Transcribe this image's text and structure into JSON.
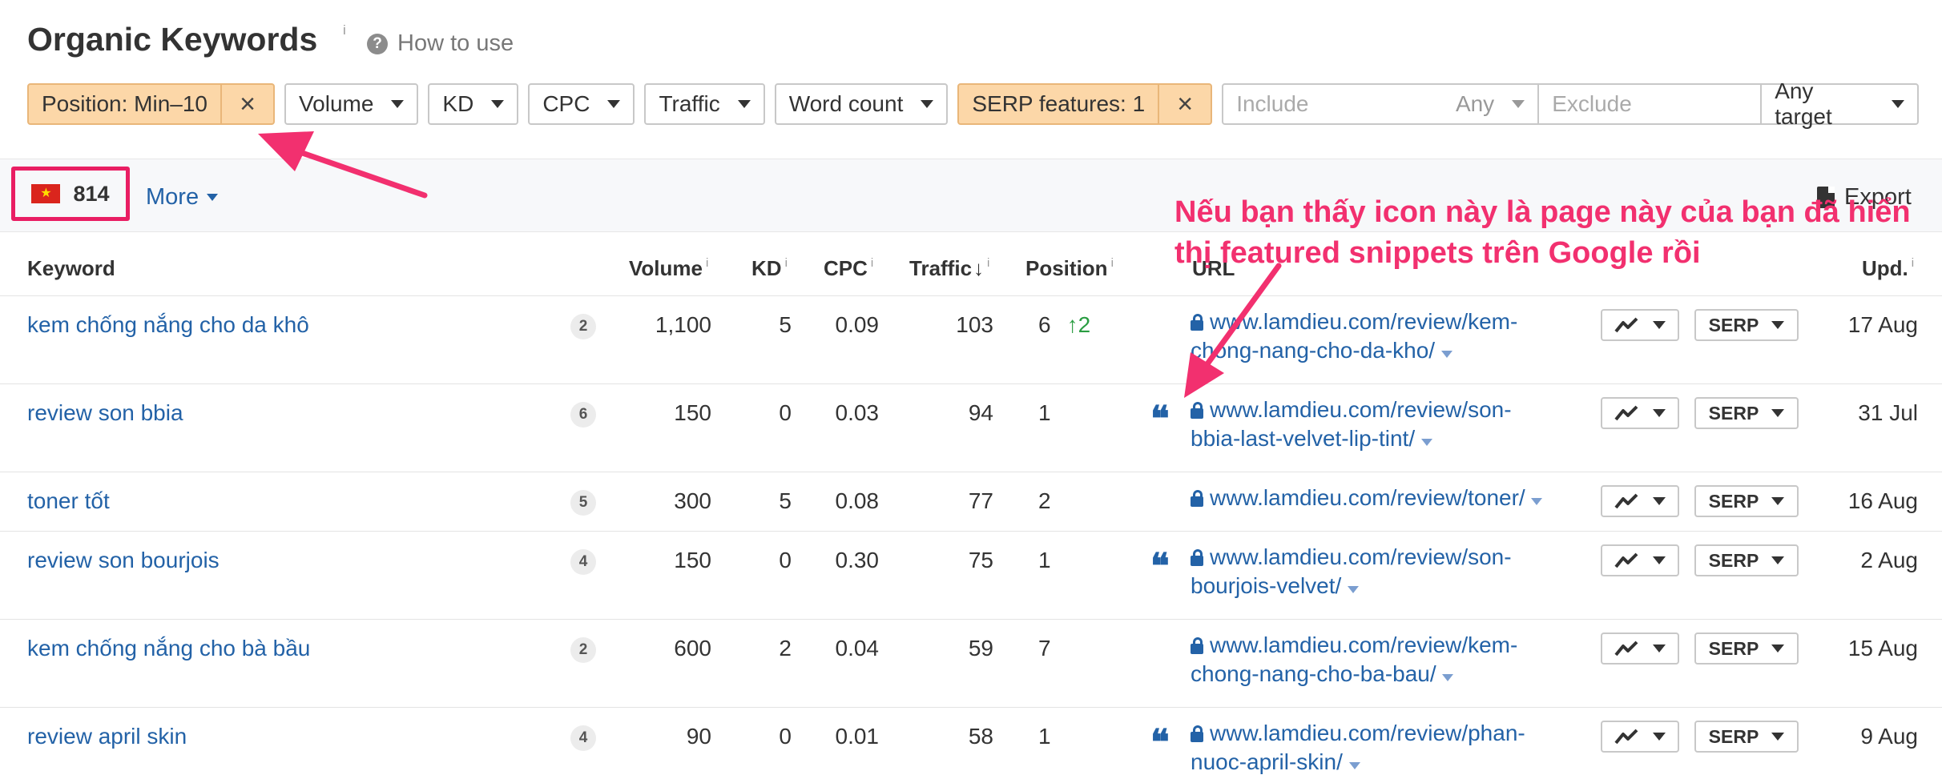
{
  "header": {
    "title": "Organic Keywords",
    "title_info": "i",
    "how_to_use": "How to use",
    "how_to_icon_glyph": "?"
  },
  "filters": {
    "position": "Position: Min–10",
    "volume": "Volume",
    "kd": "KD",
    "cpc": "CPC",
    "traffic": "Traffic",
    "word_count": "Word count",
    "serp_features": "SERP features: 1",
    "include_placeholder": "Include",
    "include_mode": "Any",
    "exclude_placeholder": "Exclude",
    "target": "Any target",
    "close_glyph": "×"
  },
  "summary": {
    "count": "814",
    "flag_glyph": "★",
    "more": "More",
    "export": "Export"
  },
  "table": {
    "headers": {
      "keyword": "Keyword",
      "volume": "Volume",
      "kd": "KD",
      "cpc": "CPC",
      "traffic": "Traffic",
      "traffic_arrow": "↓",
      "position": "Position",
      "url": "URL",
      "updated": "Upd.",
      "info": "i"
    },
    "serp_label": "SERP",
    "quote_glyph": "❝",
    "rows": [
      {
        "keyword": "kem chống nắng cho da khô",
        "words": "2",
        "volume": "1,100",
        "kd": "5",
        "cpc": "0.09",
        "traffic": "103",
        "position": "6",
        "change": "↑2",
        "url": "www.lamdieu.com/review/kem-chong-nang-cho-da-kho/",
        "updated": "17 Aug"
      },
      {
        "keyword": "review son bbia",
        "words": "6",
        "volume": "150",
        "kd": "0",
        "cpc": "0.03",
        "traffic": "94",
        "position": "1",
        "change": "",
        "url": "www.lamdieu.com/review/son-bbia-last-velvet-lip-tint/",
        "updated": "31 Jul"
      },
      {
        "keyword": "toner tốt",
        "words": "5",
        "volume": "300",
        "kd": "5",
        "cpc": "0.08",
        "traffic": "77",
        "position": "2",
        "change": "",
        "url": "www.lamdieu.com/review/toner/",
        "updated": "16 Aug"
      },
      {
        "keyword": "review son bourjois",
        "words": "4",
        "volume": "150",
        "kd": "0",
        "cpc": "0.30",
        "traffic": "75",
        "position": "1",
        "change": "",
        "url": "www.lamdieu.com/review/son-bourjois-velvet/",
        "updated": "2 Aug"
      },
      {
        "keyword": "kem chống nắng cho bà bầu",
        "words": "2",
        "volume": "600",
        "kd": "2",
        "cpc": "0.04",
        "traffic": "59",
        "position": "7",
        "change": "",
        "url": "www.lamdieu.com/review/kem-chong-nang-cho-ba-bau/",
        "updated": "15 Aug"
      },
      {
        "keyword": "review april skin",
        "words": "4",
        "volume": "90",
        "kd": "0",
        "cpc": "0.01",
        "traffic": "58",
        "position": "1",
        "change": "",
        "url": "www.lamdieu.com/review/phan-nuoc-april-skin/",
        "updated": "9 Aug"
      }
    ]
  },
  "annotation": {
    "text": "Nếu bạn thấy icon này là page này của bạn đã hiển thị featured snippets trên Google rồi",
    "color": "#f2306f"
  },
  "colors": {
    "link": "#2362a7",
    "active_filter": "#fcd7a8",
    "highlight": "#e91e63",
    "positive": "#2a9d42"
  }
}
